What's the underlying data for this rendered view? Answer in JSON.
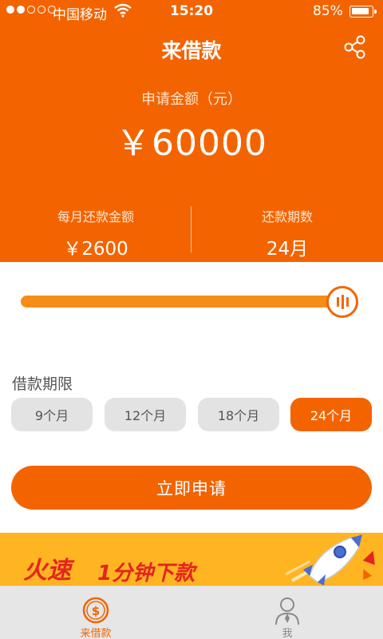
{
  "status_bar": {
    "carrier": "中国移动",
    "time": "15:20",
    "battery": "85%",
    "signal_bars": 2,
    "signal_total": 5
  },
  "nav": {
    "title": "来借款",
    "share_icon": "share-icon"
  },
  "loan": {
    "amount_label": "申请金额（元）",
    "amount_value": "￥60000",
    "monthly_label": "每月还款金额",
    "monthly_value": "￥2600",
    "periods_label": "还款期数",
    "periods_value": "24月"
  },
  "slider": {
    "level": 1.0,
    "accent": "#f58d16"
  },
  "term": {
    "label": "借款期限",
    "options": [
      "9个月",
      "12个月",
      "18个月",
      "24个月"
    ],
    "selected": "24个月"
  },
  "apply_button": {
    "label": "立即申请"
  },
  "banner": {
    "slogan_main": "火速",
    "slogan_rest": "1分钟下款"
  },
  "tabbar": {
    "tabs": [
      {
        "label": "来借款",
        "icon": "coin-icon",
        "active": true
      },
      {
        "label": "我",
        "icon": "person-icon",
        "active": false
      }
    ]
  },
  "colors": {
    "brand": "#f36400",
    "banner_bg": "#ffb522",
    "slogan": "#e5241d"
  }
}
